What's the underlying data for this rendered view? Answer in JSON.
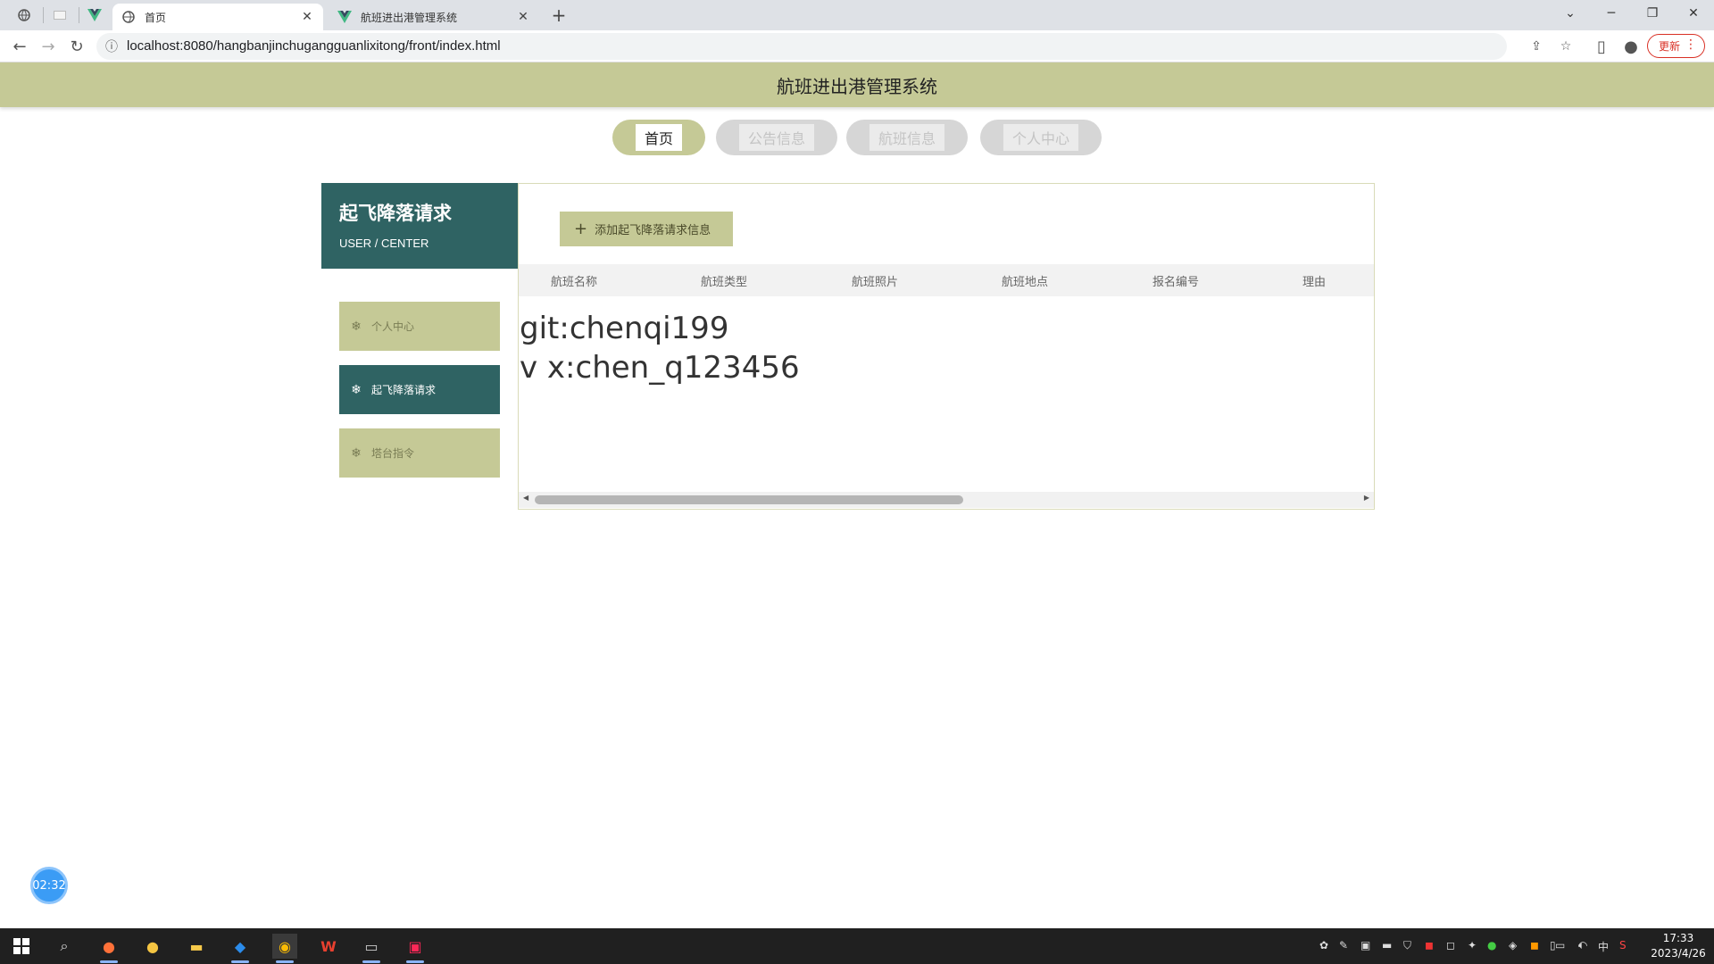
{
  "browser": {
    "tabs": [
      {
        "label": "首页",
        "active": true
      },
      {
        "label": "航班进出港管理系统",
        "active": false
      }
    ],
    "url": "localhost:8080/hangbanjinchugangguanlixitong/front/index.html",
    "update_label": "更新"
  },
  "site": {
    "title": "航班进出港管理系统",
    "nav": [
      {
        "label": "首页",
        "active": true
      },
      {
        "label": "公告信息",
        "active": false
      },
      {
        "label": "航班信息",
        "active": false
      },
      {
        "label": "个人中心",
        "active": false
      }
    ]
  },
  "sidebar": {
    "title": "起飞降落请求",
    "subtitle": "USER / CENTER",
    "items": [
      {
        "label": "个人中心",
        "active": false
      },
      {
        "label": "起飞降落请求",
        "active": true
      },
      {
        "label": "塔台指令",
        "active": false
      }
    ]
  },
  "content": {
    "add_button": "添加起飞降落请求信息",
    "columns": [
      "航班名称",
      "航班类型",
      "航班照片",
      "航班地点",
      "报名编号",
      "理由"
    ]
  },
  "watermark": {
    "line1": "git:chenqi199",
    "line2": "v x:chen_q123456"
  },
  "timer": "02:32",
  "taskbar": {
    "time": "17:33",
    "date": "2023/4/26",
    "ime": "中"
  },
  "colors": {
    "accent_olive": "#c5c996",
    "accent_teal": "#2f6363"
  }
}
